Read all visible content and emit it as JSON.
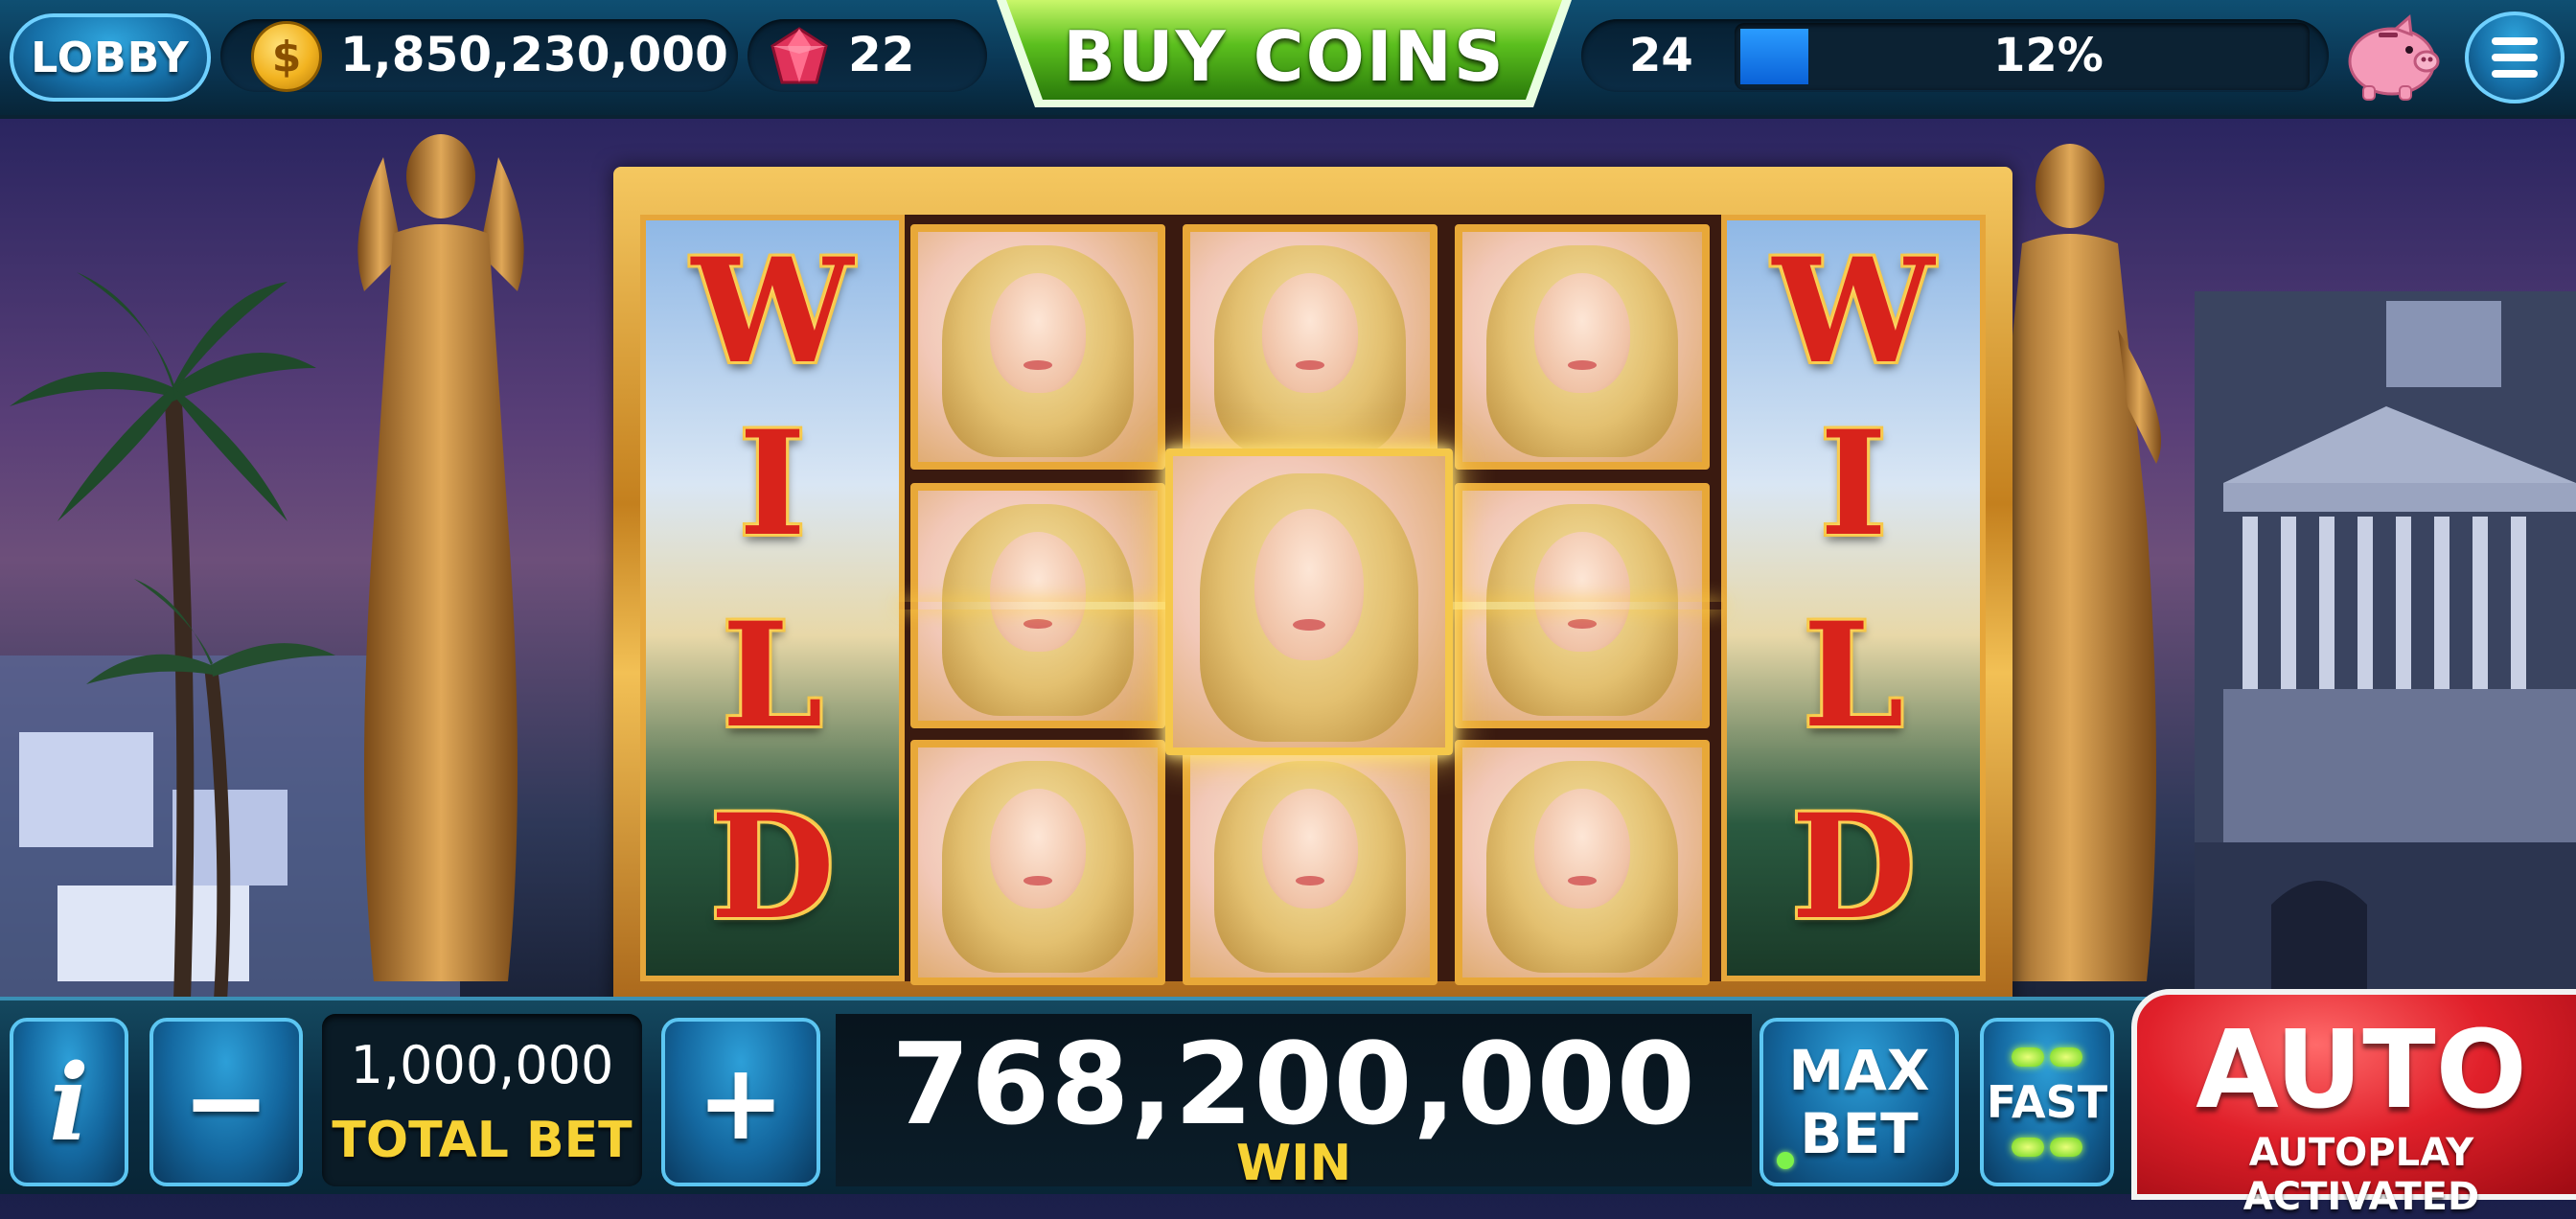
{
  "topbar": {
    "lobby_label": "LOBBY",
    "coin_balance": "1,850,230,000",
    "gem_count": "22",
    "buy_coins_label": "BUY COINS",
    "level": "24",
    "xp_percent_label": "12%",
    "xp_fraction": 0.12,
    "coin_symbol": "$"
  },
  "reels": {
    "wild_text": "WILD",
    "wild_letters": [
      "W",
      "I",
      "L",
      "D"
    ]
  },
  "bottombar": {
    "info_label": "i",
    "minus_label": "−",
    "plus_label": "+",
    "bet_amount": "1,000,000",
    "bet_label": "TOTAL BET",
    "win_amount": "768,200,000",
    "win_label": "WIN",
    "maxbet_line1": "MAX",
    "maxbet_line2": "BET",
    "fast_label": "FAST",
    "auto_label": "AUTO",
    "auto_sub": "AUTOPLAY ACTIVATED"
  },
  "colors": {
    "accent_blue": "#1670a8",
    "buy_coins_green": "#5bbf1e",
    "bet_label_yellow": "#f7d234",
    "auto_red": "#e0202a",
    "wild_red": "#d8231b",
    "frame_gold": "#e8a838"
  },
  "icons": {
    "coin": "gold-coin-icon",
    "gem": "red-gem-icon",
    "piggy": "piggy-bank-icon",
    "menu": "hamburger-menu-icon"
  }
}
